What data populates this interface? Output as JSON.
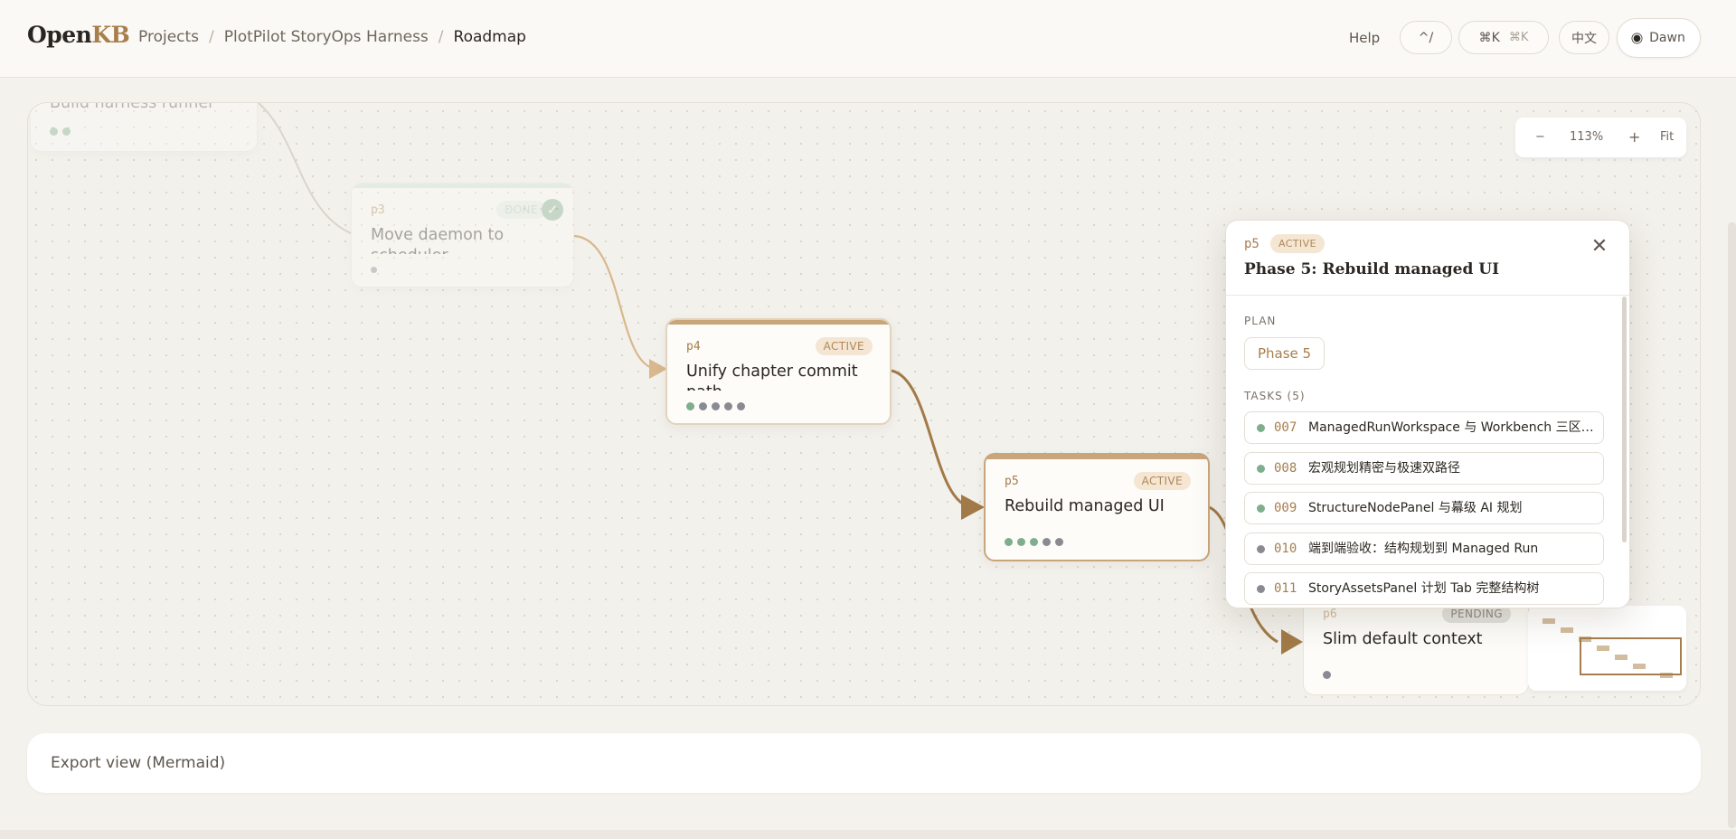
{
  "header": {
    "logo_open": "Open",
    "logo_kb": "KB",
    "breadcrumbs": [
      "Projects",
      "PlotPilot StoryOps Harness",
      "Roadmap"
    ],
    "help": "Help",
    "kbd_slash": "^/",
    "kbd_cmdk": "⌘K",
    "kbd_cmdk_dim": "⌘K",
    "lang": "中文",
    "theme": "Dawn"
  },
  "canvas": {
    "zoom": {
      "minus": "−",
      "level": "113%",
      "plus": "+",
      "fit": "Fit"
    },
    "nodes": [
      {
        "id": "",
        "title": "Build harness runner",
        "status": "",
        "dots": [
          "g",
          "g"
        ]
      },
      {
        "id": "p3",
        "title": "Move daemon to scheduler",
        "status": "DONE",
        "dots": [
          "n"
        ]
      },
      {
        "id": "p4",
        "title": "Unify chapter commit path",
        "status": "ACTIVE",
        "dots": [
          "g",
          "n",
          "n",
          "n",
          "n"
        ]
      },
      {
        "id": "p5",
        "title": "Rebuild managed UI",
        "status": "ACTIVE",
        "dots": [
          "g",
          "g",
          "g",
          "n",
          "n"
        ]
      },
      {
        "id": "p6",
        "title": "Slim default context",
        "status": "PENDING",
        "dots": [
          "n"
        ]
      }
    ]
  },
  "panel": {
    "id": "p5",
    "badge": "ACTIVE",
    "title": "Phase 5: Rebuild managed UI",
    "plan_label": "PLAN",
    "plan_value": "Phase 5",
    "tasks_label": "TASKS (5)",
    "tasks": [
      {
        "num": "007",
        "text": "ManagedRunWorkspace 与 Workbench 三区…",
        "status": "done"
      },
      {
        "num": "008",
        "text": "宏观规划精密与极速双路径",
        "status": "done"
      },
      {
        "num": "009",
        "text": "StructureNodePanel 与幕级 AI 规划",
        "status": "done"
      },
      {
        "num": "010",
        "text": "端到端验收：结构规划到 Managed Run",
        "status": "todo"
      },
      {
        "num": "011",
        "text": "StoryAssetsPanel 计划 Tab 完整结构树",
        "status": "todo"
      }
    ]
  },
  "export": {
    "label": "Export view (Mermaid)"
  },
  "colors": {
    "accent": "#a67e4d",
    "done": "#7fae8c",
    "todo": "#8a8a92"
  }
}
